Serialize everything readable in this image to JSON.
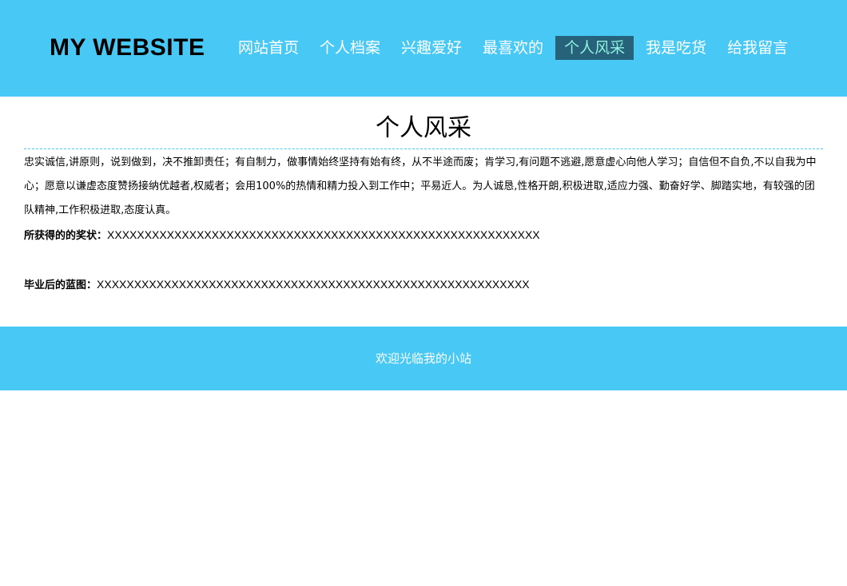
{
  "header": {
    "logo": "MY WEBSITE",
    "nav": [
      {
        "label": "网站首页",
        "active": false
      },
      {
        "label": "个人档案",
        "active": false
      },
      {
        "label": "兴趣爱好",
        "active": false
      },
      {
        "label": "最喜欢的",
        "active": false
      },
      {
        "label": "个人风采",
        "active": true
      },
      {
        "label": "我是吃货",
        "active": false
      },
      {
        "label": "给我留言",
        "active": false
      }
    ]
  },
  "main": {
    "title": "个人风采",
    "intro": "忠实诚信,讲原则，说到做到，决不推卸责任；有自制力，做事情始终坚持有始有终，从不半途而废；肯学习,有问题不逃避,愿意虚心向他人学习；自信但不自负,不以自我为中心；愿意以谦虚态度赞扬接纳优越者,权威者；会用100%的热情和精力投入到工作中；平易近人。为人诚恳,性格开朗,积极进取,适应力强、勤奋好学、脚踏实地，有较强的团队精神,工作积极进取,态度认真。",
    "awards_label": "所获得的的奖状：",
    "awards_value": "XXXXXXXXXXXXXXXXXXXXXXXXXXXXXXXXXXXXXXXXXXXXXXXXXXXXXXXXXX",
    "blueprint_label": "毕业后的蓝图：",
    "blueprint_value": "XXXXXXXXXXXXXXXXXXXXXXXXXXXXXXXXXXXXXXXXXXXXXXXXXXXXXXXXXX"
  },
  "footer": {
    "text": "欢迎光临我的小站"
  },
  "colors": {
    "header_bg": "#48c8f4",
    "nav_active_bg": "#26627a",
    "nav_active_text": "#8ff0e0",
    "footer_bg": "#48c8f4"
  }
}
